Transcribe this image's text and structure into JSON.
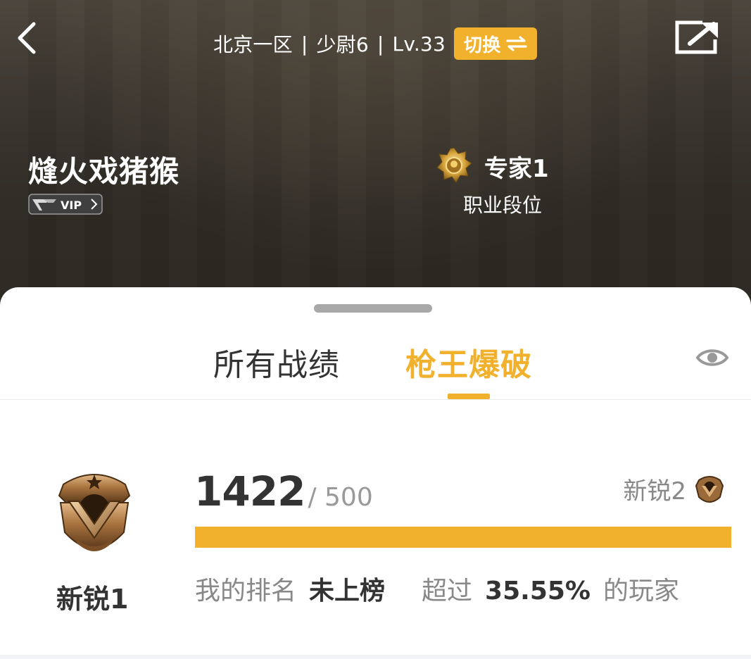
{
  "header": {
    "server": "北京一区",
    "rank_title": "少尉6",
    "level": "Lv.33",
    "separator": "|",
    "switch_label": "切换",
    "player_name": "熢火戏猪猴",
    "vip_label": "VIP",
    "pro_rank": "专家1",
    "pro_rank_caption": "职业段位"
  },
  "tabs": {
    "items": [
      {
        "label": "所有战绩",
        "active": false
      },
      {
        "label": "枪王爆破",
        "active": true
      }
    ]
  },
  "stats": {
    "current_rank": "新锐1",
    "score": "1422",
    "score_total": "/ 500",
    "next_rank": "新锐2",
    "progress_fraction": 1.0,
    "my_rank_label": "我的排名",
    "my_rank_value": "未上榜",
    "exceed_label": "超过",
    "exceed_percent": "35.55%",
    "exceed_suffix": "的玩家"
  },
  "colors": {
    "accent": "#f2b12c",
    "text_dark": "#333333",
    "text_muted": "#888888"
  },
  "icons": {
    "back": "chevron-left-icon",
    "switch": "swap-arrows-icon",
    "share": "share-icon",
    "eye": "eye-icon",
    "pro_rank": "gold-emblem-icon",
    "current_rank": "bronze-shield-icon",
    "next_rank": "bronze-small-shield-icon"
  }
}
